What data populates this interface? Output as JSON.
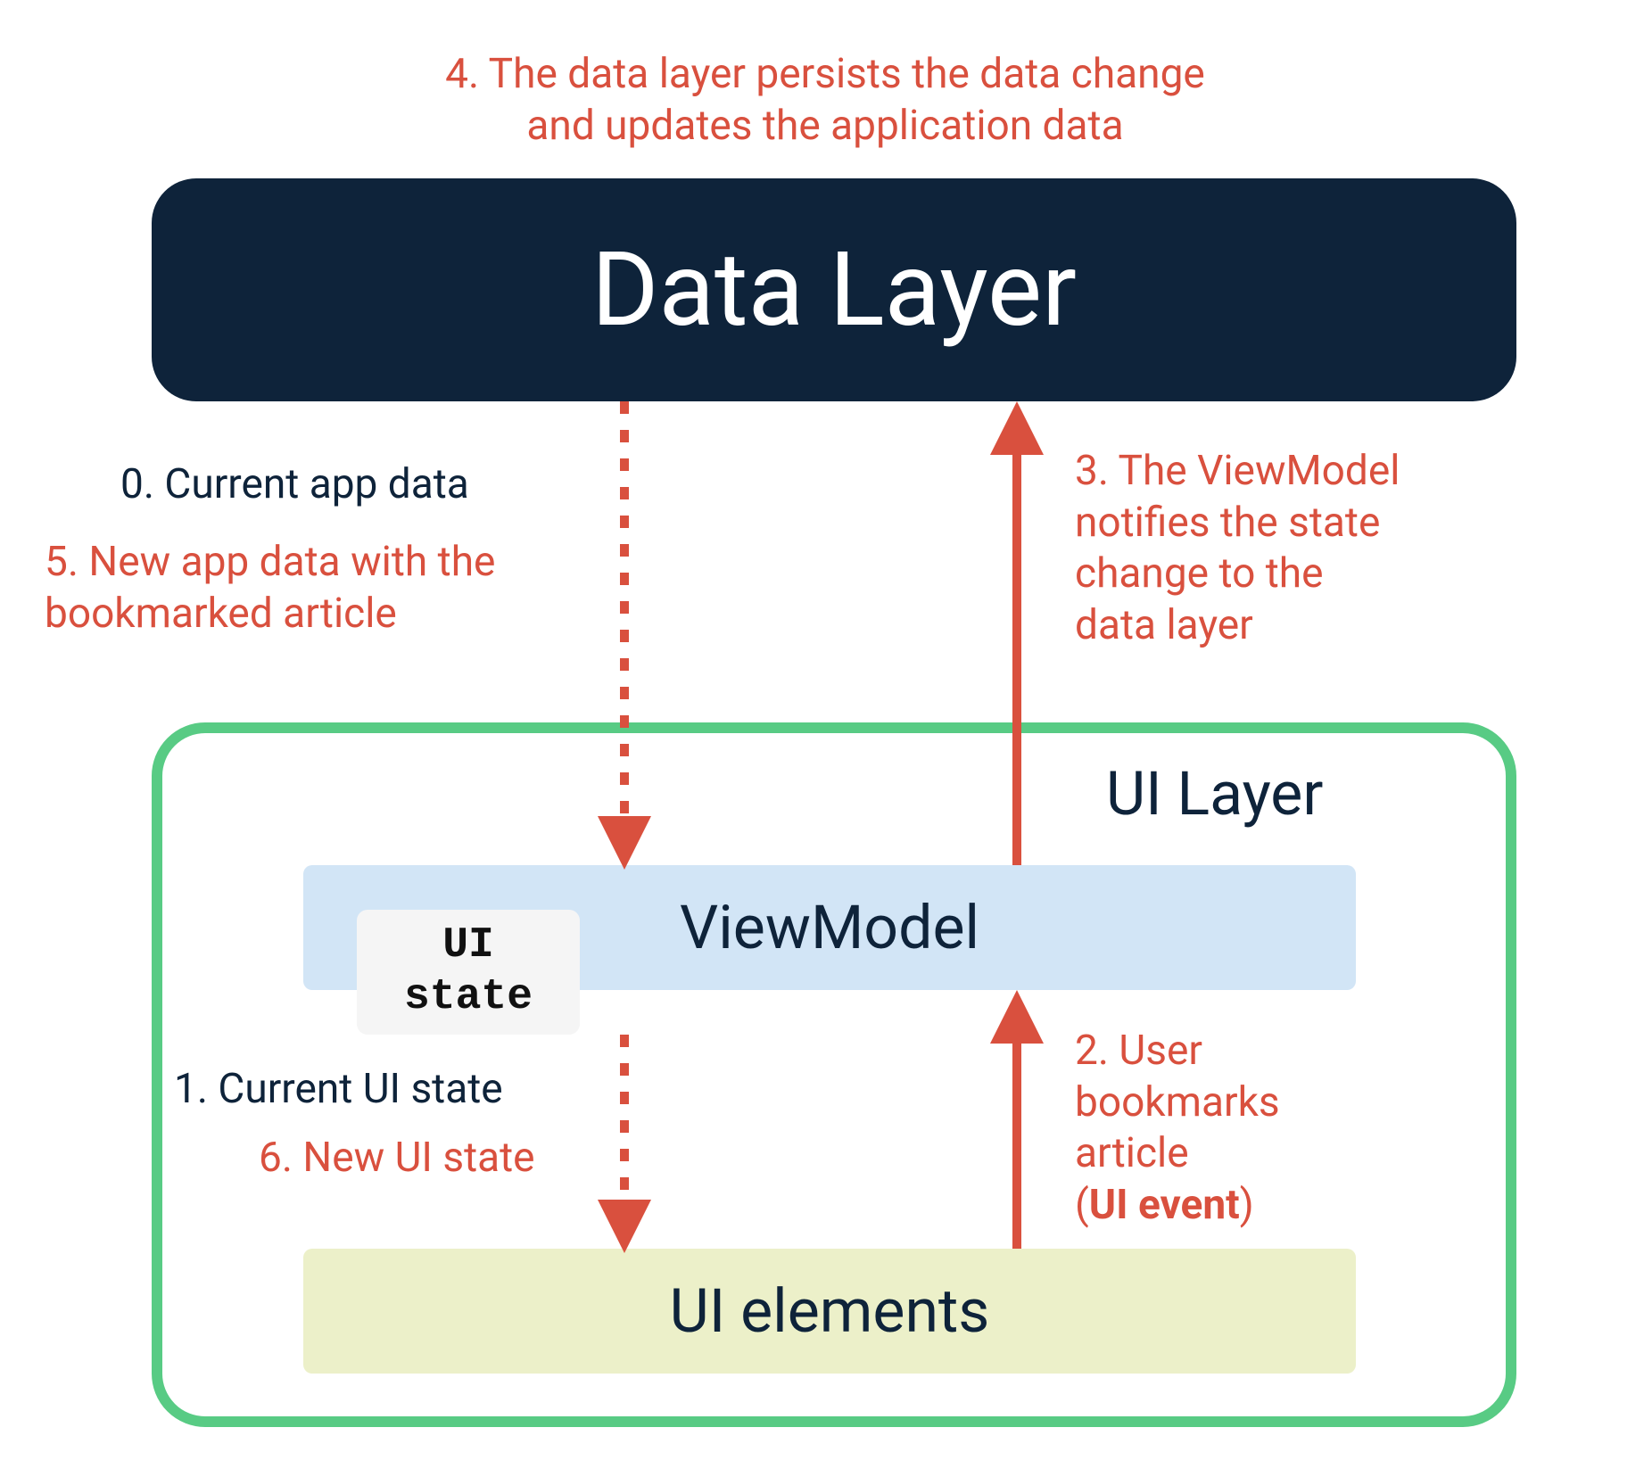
{
  "boxes": {
    "data_layer": "Data Layer",
    "ui_layer": "UI Layer",
    "view_model": "ViewModel",
    "ui_state_line1": "UI",
    "ui_state_line2": "state",
    "ui_elements": "UI elements"
  },
  "annotations": {
    "top_line1": "4. The data layer persists the data change",
    "top_line2": "and updates the application data",
    "left_upper_dark": "0. Current app data",
    "left_upper_red_l1": "5. New app data with the",
    "left_upper_red_l2": "bookmarked article",
    "right_upper_l1": "3. The ViewModel",
    "right_upper_l2": "notifies the state",
    "right_upper_l3": "change to the",
    "right_upper_l4": "data layer",
    "left_lower_dark": "1. Current UI state",
    "left_lower_red": "6. New UI state",
    "right_lower_l1": "2. User",
    "right_lower_l2": "bookmarks",
    "right_lower_l3": "article",
    "right_lower_l4a": "(",
    "right_lower_l4b": "UI event",
    "right_lower_l4c": ")"
  },
  "colors": {
    "red": "#d9503e",
    "dark": "#0e233a",
    "green": "#58cb84",
    "lightblue": "#d2e5f6",
    "lightyellow": "#ecf0c9",
    "grey": "#f5f5f5"
  }
}
